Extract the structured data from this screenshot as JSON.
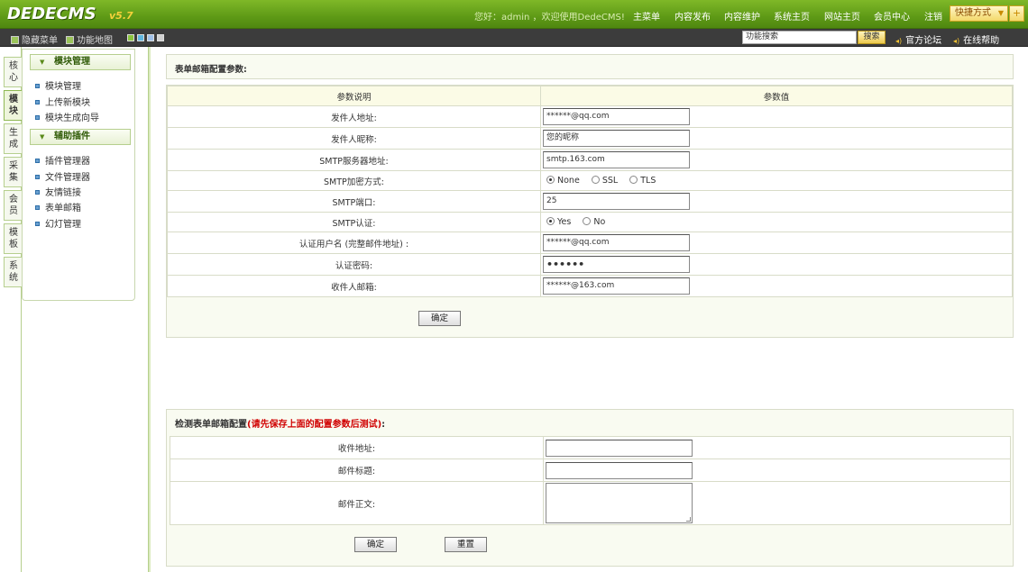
{
  "brand": {
    "logo": "DEDECMS",
    "version": "v5.7"
  },
  "topbar": {
    "welcome": "您好：admin ，欢迎使用DedeCMS!",
    "nav": [
      "主菜单",
      "内容发布",
      "内容维护",
      "系统主页",
      "网站主页",
      "会员中心",
      "注销"
    ],
    "quick_label": "快捷方式",
    "plus_label": "+"
  },
  "subbar": {
    "hide_menu": "隐藏菜单",
    "func_map": "功能地图",
    "search_value": "功能搜索",
    "search_button": "搜索",
    "forum": "官方论坛",
    "help": "在线帮助",
    "swatch_colors": [
      "#8ac43e",
      "#5fb6e0",
      "#a0c0e8",
      "#d0d0d0"
    ]
  },
  "lefttabs": [
    "核心",
    "模块",
    "生成",
    "采集",
    "会员",
    "模板",
    "系统"
  ],
  "leftmenu": {
    "group1": {
      "title": "模块管理",
      "items": [
        "模块管理",
        "上传新模块",
        "模块生成向导"
      ]
    },
    "group2": {
      "title": "辅助插件",
      "items": [
        "插件管理器",
        "文件管理器",
        "友情链接",
        "表单邮箱",
        "幻灯管理"
      ]
    }
  },
  "config": {
    "title": "表单邮箱配置参数:",
    "col_param": "参数说明",
    "col_value": "参数值",
    "rows": {
      "sender": {
        "label": "发件人地址:",
        "value": "******@qq.com"
      },
      "nickname": {
        "label": "发件人昵称:",
        "value": "您的昵称"
      },
      "smtp_server": {
        "label": "SMTP服务器地址:",
        "value": "smtp.163.com"
      },
      "smtp_enc": {
        "label": "SMTP加密方式:",
        "options": [
          "None",
          "SSL",
          "TLS"
        ],
        "selected": "None"
      },
      "smtp_port": {
        "label": "SMTP端口:",
        "value": "25"
      },
      "smtp_auth": {
        "label": "SMTP认证:",
        "options": [
          "Yes",
          "No"
        ],
        "selected": "Yes"
      },
      "auth_user": {
        "label": "认证用户名 (完整邮件地址) :",
        "value": "******@qq.com"
      },
      "auth_pass": {
        "label": "认证密码:",
        "value": "••••••"
      },
      "receiver": {
        "label": "收件人邮箱:",
        "value": "******@163.com"
      }
    },
    "submit": "确定"
  },
  "test": {
    "title": "检测表单邮箱配置",
    "note": "(请先保存上面的配置参数后测试)",
    "colon": ":",
    "rows": {
      "to": {
        "label": "收件地址:",
        "value": ""
      },
      "subject": {
        "label": "邮件标题:",
        "value": ""
      },
      "body": {
        "label": "邮件正文:",
        "value": ""
      }
    },
    "submit": "确定",
    "reset": "重置"
  }
}
